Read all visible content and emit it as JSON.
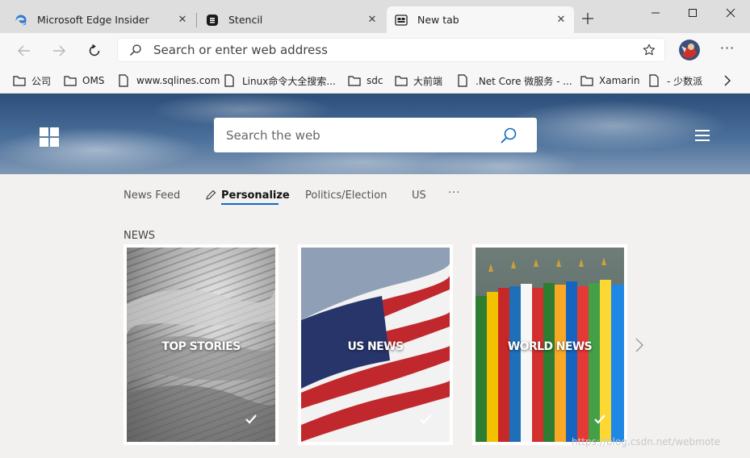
{
  "tabs": [
    {
      "title": "Microsoft Edge Insider",
      "icon": "edge-icon"
    },
    {
      "title": "Stencil",
      "icon": "stencil-icon"
    },
    {
      "title": "New tab",
      "icon": "newtab-icon",
      "active": true
    }
  ],
  "window_controls": {
    "minimize": "minimize-icon",
    "maximize": "maximize-icon",
    "close": "close-icon"
  },
  "address_bar": {
    "placeholder": "Search or enter web address",
    "value": ""
  },
  "favorites": [
    {
      "label": "公司",
      "icon": "folder-icon"
    },
    {
      "label": "OMS",
      "icon": "folder-icon"
    },
    {
      "label": "www.sqlines.com",
      "icon": "page-icon"
    },
    {
      "label": "Linux命令大全搜索...",
      "icon": "page-icon"
    },
    {
      "label": "sdc",
      "icon": "folder-icon"
    },
    {
      "label": "大前端",
      "icon": "folder-icon"
    },
    {
      "label": ".Net Core 微服务 - ...",
      "icon": "page-icon"
    },
    {
      "label": "Xamarin",
      "icon": "folder-icon"
    },
    {
      "label": "- 少数派",
      "icon": "page-icon"
    }
  ],
  "hero": {
    "search_placeholder": "Search the web"
  },
  "feed_tabs": [
    {
      "label": "News Feed"
    },
    {
      "label": "Personalize",
      "selected": true
    },
    {
      "label": "Politics/Election"
    },
    {
      "label": "US"
    }
  ],
  "section": {
    "title": "NEWS"
  },
  "cards": [
    {
      "caption": "TOP STORIES",
      "checked": true
    },
    {
      "caption": "US NEWS",
      "checked": true
    },
    {
      "caption": "WORLD NEWS",
      "checked": true
    }
  ],
  "watermark": "https://blog.csdn.net/webmote",
  "colors": {
    "accent": "#0f6cbd",
    "titlebar": "#dedede",
    "toolbar": "#f7f7f7",
    "page": "#f2f1f0"
  }
}
